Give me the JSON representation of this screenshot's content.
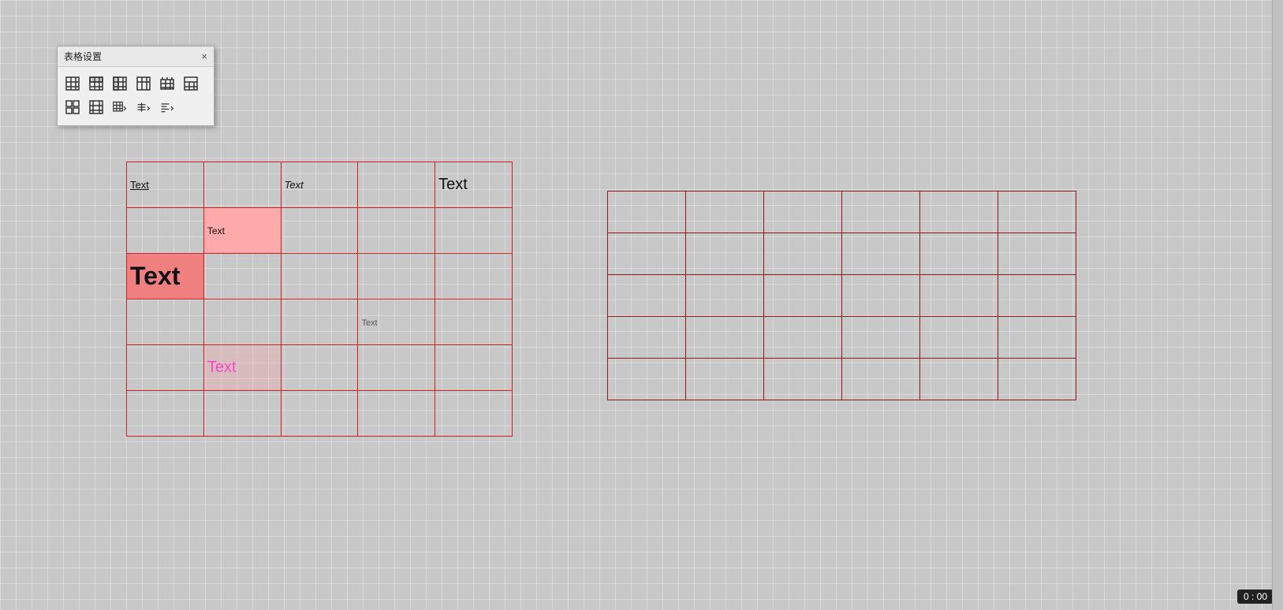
{
  "panel": {
    "title": "表格设置",
    "close_label": "×",
    "icons": [
      {
        "name": "table-style-1",
        "symbol": "⊞"
      },
      {
        "name": "table-style-2",
        "symbol": "⊟"
      },
      {
        "name": "table-style-3",
        "symbol": "⊠"
      },
      {
        "name": "table-style-4",
        "symbol": "⊡"
      },
      {
        "name": "table-style-5",
        "symbol": "▦"
      },
      {
        "name": "table-style-6",
        "symbol": "▣"
      },
      {
        "name": "table-style-7",
        "symbol": "⊞"
      },
      {
        "name": "table-style-8",
        "symbol": "⊞"
      },
      {
        "name": "border-style",
        "symbol": "▭"
      },
      {
        "name": "align-vertical",
        "symbol": "⊥"
      },
      {
        "name": "align-text",
        "symbol": "≡"
      }
    ]
  },
  "left_table": {
    "cells": {
      "r1c1": "Text",
      "r1c3": "Text",
      "r1c5": "Text",
      "r2c2": "Text",
      "r3c1": "Text",
      "r4c4": "Text",
      "r5c2": "Text"
    }
  },
  "timer": "0 : 00"
}
